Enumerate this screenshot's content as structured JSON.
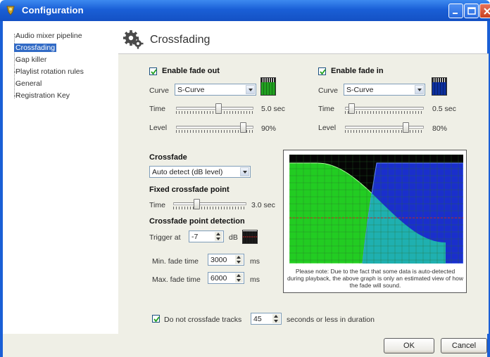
{
  "window": {
    "title": "Configuration"
  },
  "tree": {
    "items": [
      {
        "label": "Audio mixer pipeline",
        "selected": false
      },
      {
        "label": "Crossfading",
        "selected": true
      },
      {
        "label": "Gap killer",
        "selected": false
      },
      {
        "label": "Playlist rotation rules",
        "selected": false
      },
      {
        "label": "General",
        "selected": false
      },
      {
        "label": "Registration Key",
        "selected": false
      }
    ]
  },
  "page": {
    "title": "Crossfading"
  },
  "fade_out": {
    "enabled_label": "Enable fade out",
    "checked": true,
    "curve_label": "Curve",
    "curve_value": "S-Curve",
    "time_label": "Time",
    "time_value": "5.0 sec",
    "time_fraction": 0.55,
    "level_label": "Level",
    "level_value": "90%",
    "level_fraction": 0.9,
    "swatch_color": "#21a121"
  },
  "fade_in": {
    "enabled_label": "Enable fade in",
    "checked": true,
    "curve_label": "Curve",
    "curve_value": "S-Curve",
    "time_label": "Time",
    "time_value": "0.5 sec",
    "time_fraction": 0.05,
    "level_label": "Level",
    "level_value": "80%",
    "level_fraction": 0.8,
    "swatch_color": "#0c2f9e"
  },
  "crossfade": {
    "heading": "Crossfade",
    "mode_value": "Auto detect (dB level)",
    "fixed_heading": "Fixed crossfade point",
    "time_label": "Time",
    "time_value": "3.0 sec",
    "time_fraction": 0.3,
    "detection_heading": "Crossfade point detection",
    "trigger_label": "Trigger at",
    "trigger_value": "-7",
    "trigger_unit": "dB",
    "min_label": "Min. fade time",
    "min_value": "3000",
    "min_unit": "ms",
    "max_label": "Max. fade time",
    "max_value": "6000",
    "max_unit": "ms"
  },
  "graph": {
    "note": "Please note: Due to the fact that some data is auto-detected during playback, the above graph is only an estimated view of how the fade will sound.",
    "fade_out_color": "#22cc22",
    "fade_in_color": "#1a2fcc",
    "overlap_color": "#1fb0b0",
    "background_color": "#050505",
    "grid_color": "#2a6a2a",
    "threshold_color": "#cc2222"
  },
  "short_tracks": {
    "checked": true,
    "label": "Do not crossfade tracks",
    "value": "45",
    "suffix": "seconds or less in duration"
  },
  "buttons": {
    "ok": "OK",
    "cancel": "Cancel"
  }
}
